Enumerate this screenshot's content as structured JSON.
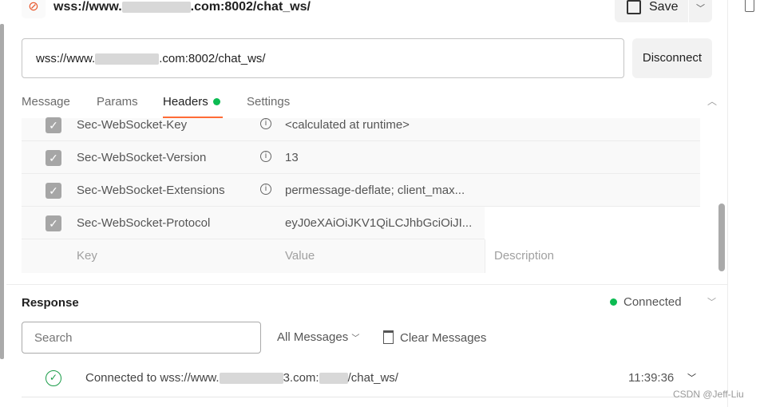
{
  "header": {
    "title_prefix": "wss://www.",
    "title_suffix": ".com:8002/chat_ws/",
    "save_label": "Save"
  },
  "url": {
    "prefix": "wss://www.",
    "suffix": ".com:8002/chat_ws/",
    "disconnect_label": "Disconnect"
  },
  "tabs": [
    {
      "label": "Message"
    },
    {
      "label": "Params"
    },
    {
      "label": "Headers",
      "active": true
    },
    {
      "label": "Settings"
    }
  ],
  "headers": {
    "rows": [
      {
        "key": "Sec-WebSocket-Key",
        "value": "<calculated at runtime>",
        "info": true,
        "checked": true
      },
      {
        "key": "Sec-WebSocket-Version",
        "value": "13",
        "info": true,
        "checked": true
      },
      {
        "key": "Sec-WebSocket-Extensions",
        "value": "permessage-deflate; client_max...",
        "info": true,
        "checked": true
      },
      {
        "key": "Sec-WebSocket-Protocol",
        "value": "eyJ0eXAiOiJKV1QiLCJhbGciOiJI...",
        "info": false,
        "checked": true
      }
    ],
    "placeholders": {
      "key": "Key",
      "value": "Value",
      "description": "Description"
    }
  },
  "response": {
    "title": "Response",
    "status": "Connected",
    "status_color": "#0cbb52",
    "search_placeholder": "Search",
    "filter": "All Messages",
    "clear": "Clear Messages",
    "messages": [
      {
        "prefix": "Connected to wss://www.",
        "mid": "3.com:",
        "suffix": "/chat_ws/",
        "time": "11:39:36"
      }
    ]
  },
  "watermark": "CSDN @Jeff-Liu",
  "accent": "#ff6c37"
}
